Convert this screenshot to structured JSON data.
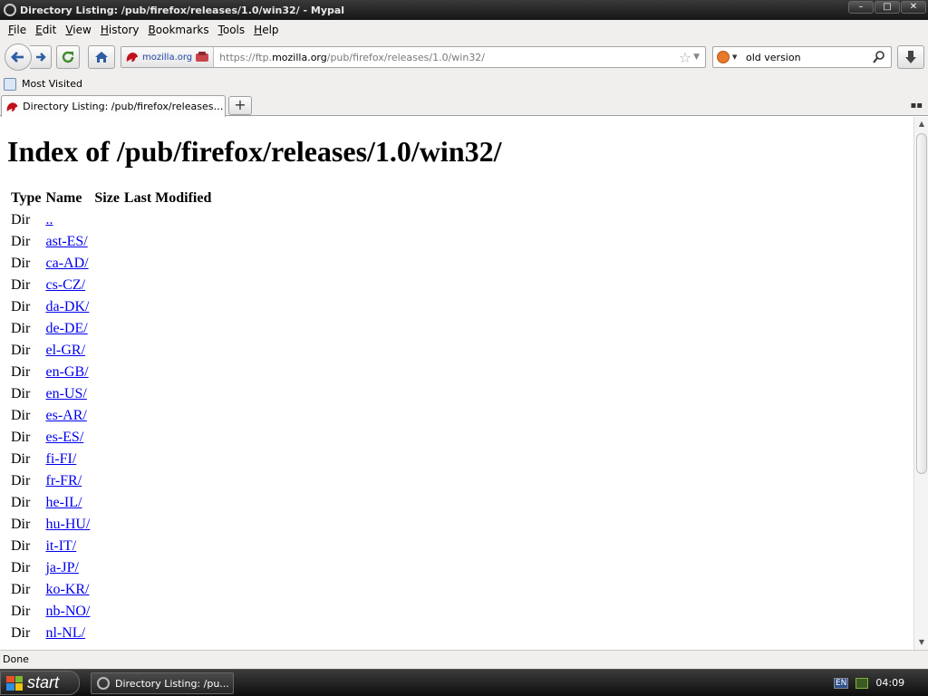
{
  "window": {
    "title": "Directory Listing: /pub/firefox/releases/1.0/win32/ - Mypal",
    "controls": [
      "–",
      "□",
      "✕"
    ]
  },
  "menu": {
    "items": [
      {
        "underline": "F",
        "rest": "ile"
      },
      {
        "underline": "E",
        "rest": "dit"
      },
      {
        "underline": "V",
        "rest": "iew"
      },
      {
        "underline": "H",
        "rest": "istory"
      },
      {
        "underline": "B",
        "rest": "ookmarks"
      },
      {
        "underline": "T",
        "rest": "ools"
      },
      {
        "underline": "H",
        "rest": "elp"
      }
    ]
  },
  "navbar": {
    "site_identity": "mozilla.org",
    "url_prefix": "https://ftp.",
    "url_domain": "mozilla.org",
    "url_path": "/pub/firefox/releases/1.0/win32/",
    "search_value": "old version"
  },
  "bookmarks": {
    "items": [
      "Most Visited"
    ]
  },
  "tabs": {
    "active_label": "Directory Listing: /pub/firefox/releases/1....",
    "new_tab": "+",
    "list_all": "▪▪"
  },
  "page": {
    "heading": "Index of /pub/firefox/releases/1.0/win32/",
    "columns": [
      "Type",
      "Name",
      "Size",
      "Last Modified"
    ],
    "rows": [
      {
        "type": "Dir",
        "name": ".."
      },
      {
        "type": "Dir",
        "name": "ast-ES/"
      },
      {
        "type": "Dir",
        "name": "ca-AD/"
      },
      {
        "type": "Dir",
        "name": "cs-CZ/"
      },
      {
        "type": "Dir",
        "name": "da-DK/"
      },
      {
        "type": "Dir",
        "name": "de-DE/"
      },
      {
        "type": "Dir",
        "name": "el-GR/"
      },
      {
        "type": "Dir",
        "name": "en-GB/"
      },
      {
        "type": "Dir",
        "name": "en-US/"
      },
      {
        "type": "Dir",
        "name": "es-AR/"
      },
      {
        "type": "Dir",
        "name": "es-ES/"
      },
      {
        "type": "Dir",
        "name": "fi-FI/"
      },
      {
        "type": "Dir",
        "name": "fr-FR/"
      },
      {
        "type": "Dir",
        "name": "he-IL/"
      },
      {
        "type": "Dir",
        "name": "hu-HU/"
      },
      {
        "type": "Dir",
        "name": "it-IT/"
      },
      {
        "type": "Dir",
        "name": "ja-JP/"
      },
      {
        "type": "Dir",
        "name": "ko-KR/"
      },
      {
        "type": "Dir",
        "name": "nb-NO/"
      },
      {
        "type": "Dir",
        "name": "nl-NL/"
      }
    ]
  },
  "status": {
    "text": "Done"
  },
  "taskbar": {
    "start_label": "start",
    "task_label": "Directory Listing: /pu...",
    "language": "EN",
    "clock": "04:09"
  },
  "colors": {
    "link": "#0000ee",
    "titlebar": "#1e1e1e"
  }
}
